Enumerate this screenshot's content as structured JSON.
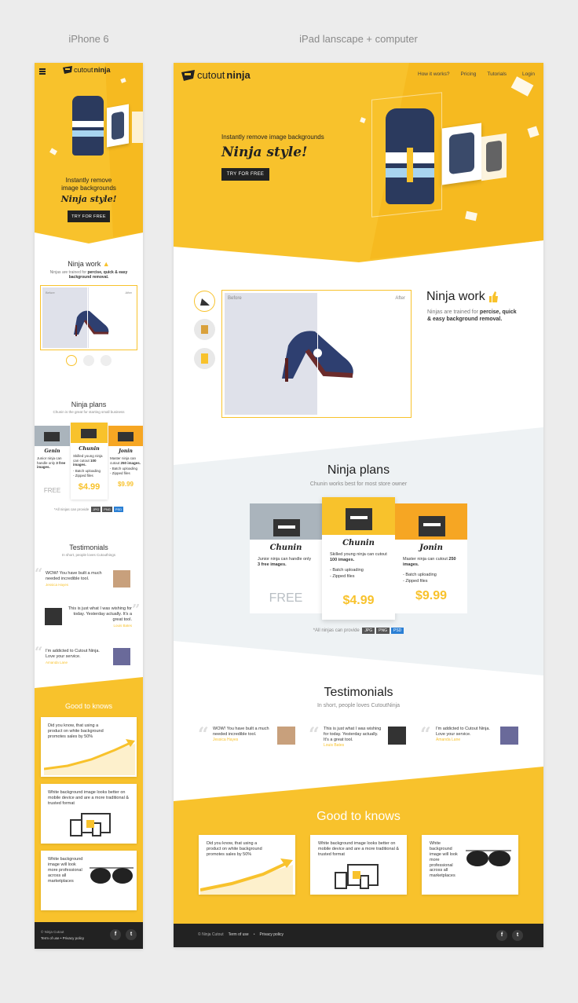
{
  "labels": {
    "phone": "iPhone 6",
    "desktop": "iPad lanscape + computer"
  },
  "brand": {
    "name_a": "cutout",
    "name_b": "ninja"
  },
  "nav": [
    "How it works?",
    "Pricing",
    "Tutorials",
    "Login"
  ],
  "hero": {
    "line1": "Instantly remove image backgrounds",
    "m_line1": "Instantly remove",
    "m_line2": "image backgrounds",
    "slogan": "Ninja style!",
    "cta": "TRY FOR FREE"
  },
  "work": {
    "title": "Ninja work",
    "desc_pre": "Ninjas are trained for ",
    "desc_bold": "percise, quick & easy background removal.",
    "before": "Before",
    "after": "After"
  },
  "plans": {
    "title": "Ninja plans",
    "desk_sub": "Chunin works best for most store owner",
    "m_sub": "Chunin is the great for starting small business",
    "items": [
      {
        "name": "Chunin",
        "m_name": "Genin",
        "desc_pre": "Junior ninja can handle only ",
        "desc_bold": "3 free images.",
        "price": "FREE",
        "features": []
      },
      {
        "name": "Chunin",
        "m_name": "Chunin",
        "desc_pre": "Skilled young ninja can cutout ",
        "desc_bold": "100 images.",
        "price": "$4.99",
        "features": [
          "- Batch uploading",
          "- Zipped files"
        ]
      },
      {
        "name": "Jonin",
        "m_name": "Jonin",
        "desc_pre": "Master ninja can cutout ",
        "desc_bold": "250 images.",
        "price": "$9.99",
        "features": [
          "- Batch uploading",
          "- Zipped files"
        ]
      }
    ],
    "formats_label": "*All ninjas can provide",
    "formats": [
      "JPG",
      "PNG",
      "PSD"
    ]
  },
  "testimonials": {
    "title": "Testimonials",
    "desk_sub": "In short, people loves CutoutNinja",
    "m_sub": "In short, people loves Cutouthings",
    "items": [
      {
        "text": "WOW! You have built a much needed incredible tool.",
        "author": "Jessica Hayes"
      },
      {
        "text": "This is just what I was wishing for today. Yesterday actually. It's a great tool.",
        "author": "Louis Bates"
      },
      {
        "text": "I'm addicted to Cutout Ninja. Love your service.",
        "author": "Amanda Lane"
      }
    ]
  },
  "knows": {
    "title": "Good to knows",
    "items": [
      "Did you know, that using a product on white background promotes sales by 50%",
      "White background image looks better on mobile device and are a more traditional & trusted format",
      "White background image will look more professional across all marketplaces"
    ]
  },
  "footer": {
    "copy": "© Ninja Cutout",
    "terms": "Term of use",
    "sep": "•",
    "privacy": "Privacy policy",
    "social": [
      "f",
      "t"
    ]
  },
  "colors": {
    "accent": "#f8c22c",
    "dark": "#222222",
    "bg": "#ececec"
  }
}
